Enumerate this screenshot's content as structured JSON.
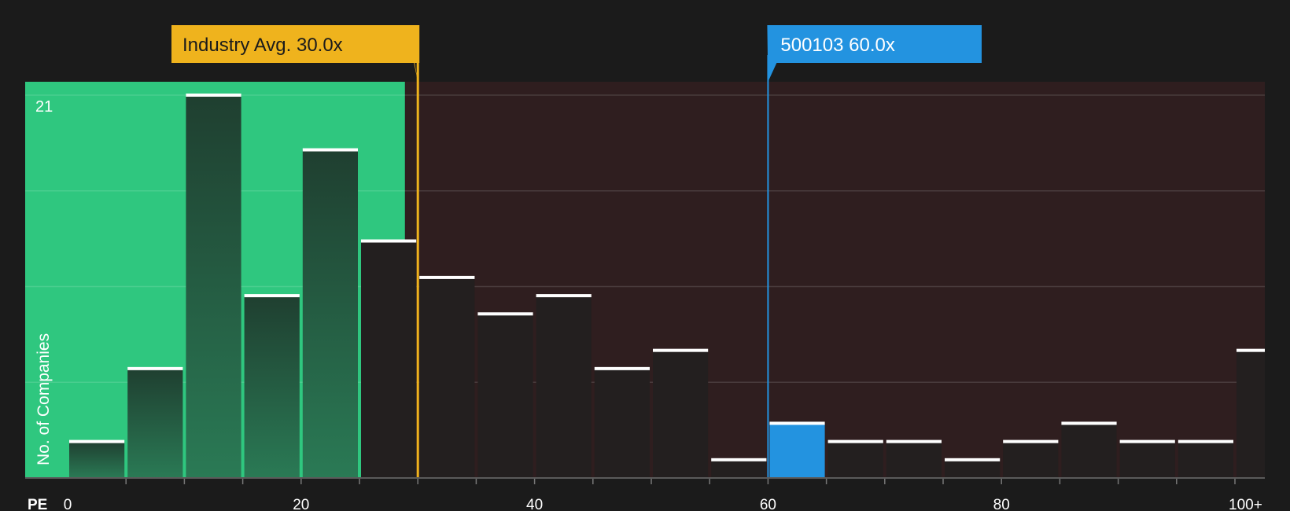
{
  "chart_data": {
    "type": "bar",
    "xlabel": "PE",
    "ylabel": "No. of Companies",
    "x_ticks": [
      {
        "value": 0,
        "label": "0"
      },
      {
        "value": 20,
        "label": "20"
      },
      {
        "value": 40,
        "label": "40"
      },
      {
        "value": 60,
        "label": "60"
      },
      {
        "value": 80,
        "label": "80"
      },
      {
        "value": 100,
        "label": "100+"
      }
    ],
    "y_max_label": "21",
    "ylim": [
      0,
      21
    ],
    "xlim": [
      -3.6,
      102.7
    ],
    "bin_width": 5,
    "bins": [
      {
        "start": 0,
        "count": 2
      },
      {
        "start": 5,
        "count": 6
      },
      {
        "start": 10,
        "count": 21
      },
      {
        "start": 15,
        "count": 10
      },
      {
        "start": 20,
        "count": 18
      },
      {
        "start": 25,
        "count": 13
      },
      {
        "start": 30,
        "count": 11
      },
      {
        "start": 35,
        "count": 9
      },
      {
        "start": 40,
        "count": 10
      },
      {
        "start": 45,
        "count": 6
      },
      {
        "start": 50,
        "count": 7
      },
      {
        "start": 55,
        "count": 1
      },
      {
        "start": 60,
        "count": 3
      },
      {
        "start": 65,
        "count": 2
      },
      {
        "start": 70,
        "count": 2
      },
      {
        "start": 75,
        "count": 1
      },
      {
        "start": 80,
        "count": 2
      },
      {
        "start": 85,
        "count": 3
      },
      {
        "start": 90,
        "count": 2
      },
      {
        "start": 95,
        "count": 2
      },
      {
        "start": 100,
        "count": 7
      }
    ],
    "highlight_bin_start": 60,
    "fair_range_end": 28.9,
    "industry_avg": {
      "value": 30.0,
      "label": "Industry Avg. 30.0x"
    },
    "company": {
      "value": 60.0,
      "label": "500103 60.0x"
    },
    "gridlines": true,
    "colors": {
      "background": "#1b1b1b",
      "fair_region": "#2fc77f",
      "above_region": "#2f1e1f",
      "bar_in_fair": "#1f4a35",
      "bar_dark": "#231f1f",
      "bar_highlight": "#2393e0",
      "bar_cap": "#ffffff",
      "industry": "#efb31d",
      "company": "#2393e0",
      "text": "#ffffff"
    }
  }
}
